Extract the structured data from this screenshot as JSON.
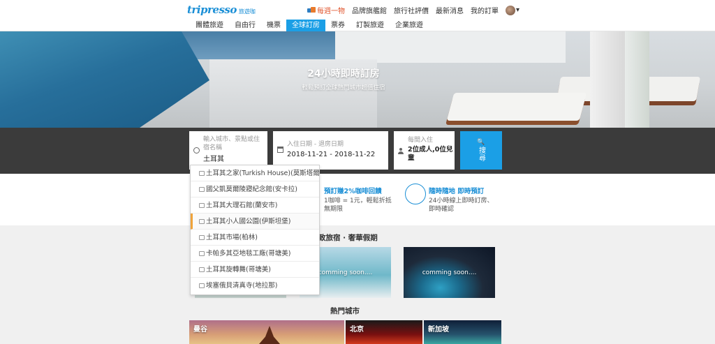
{
  "header": {
    "logo_main": "tripresso",
    "logo_sub": "旅遊咖",
    "nav": [
      "每週一物",
      "品牌旗艦館",
      "旅行社評價",
      "最新消息",
      "我的訂單"
    ],
    "caret": "▾"
  },
  "subnav": {
    "items": [
      "團體旅遊",
      "自由行",
      "機票",
      "全球訂房",
      "票券",
      "訂製旅遊",
      "企業旅遊"
    ],
    "active_index": 3
  },
  "hero": {
    "title": "24小時即時訂房",
    "subtitle": "輕鬆預訂全球熱門城市超值住宿"
  },
  "search": {
    "city_placeholder_1": "輸入城市、景點或住",
    "city_placeholder_2": "宿名稱",
    "city_value": "土耳其",
    "date_placeholder": "入住日期 - 退房日期",
    "date_value": "2018-11-21 - 2018-11-22",
    "guest_placeholder": "每間入住",
    "guest_value_1": "2位成人,0位兒",
    "guest_value_2": "童",
    "button_icon": "🔍",
    "button_label": "搜尋"
  },
  "suggestions": [
    "土耳其之家(Turkish House)(莫斯塔爾)",
    "國父凱莫爾陵寢紀念館(安卡拉)",
    "土耳其大理石館(蘭安市)",
    "土耳其小人國公園(伊斯坦堡)",
    "土耳其市場(柏林)",
    "卡帕多其亞地毯工廠(哥塘美)",
    "土耳其旋轉舞(哥塘美)",
    "埃塞俄貝清真寺(地拉那)"
  ],
  "suggestion_active_index": 3,
  "features": {
    "f1_title": "預訂賺2%咖啡回饋",
    "f1_desc_1": "1咖啡 = 1元，輕鬆折抵",
    "f1_desc_2": "無期限",
    "f2_title": "隨時隨地 即時預訂",
    "f2_desc_1": "24小時線上即時訂房、",
    "f2_desc_2": "即時確認"
  },
  "promo": {
    "title": "致旅宿 · 奢華假期",
    "cards": [
      "comming soon....",
      "comming soon...."
    ]
  },
  "cities": {
    "title": "熱門城市",
    "items": [
      "曼谷",
      "北京",
      "新加坡"
    ]
  },
  "colors": {
    "accent": "#1b9fe6",
    "active_marker": "#f0a33a",
    "search_band": "#3b3b3b",
    "hot_text": "#e0532b"
  }
}
